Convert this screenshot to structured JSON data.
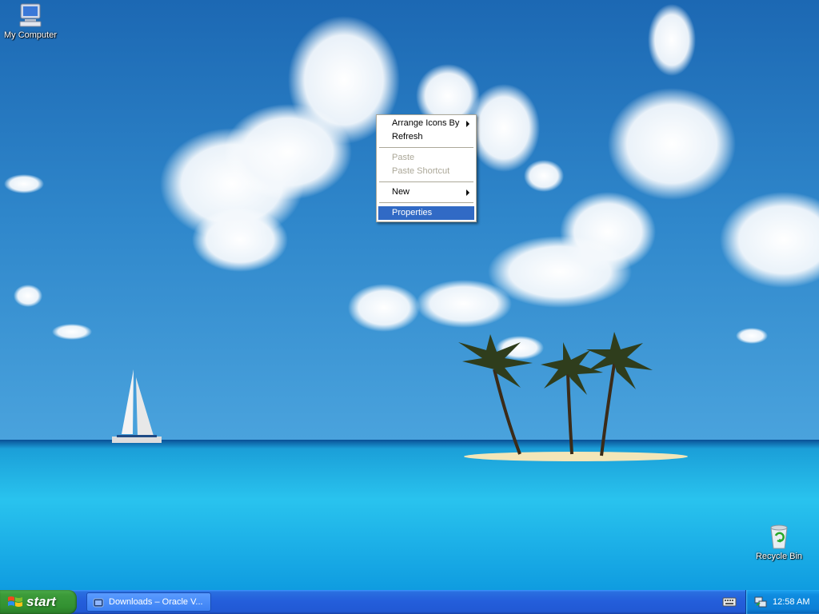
{
  "desktop": {
    "icons": [
      {
        "label": "My Computer",
        "icon": "my-computer-icon"
      },
      {
        "label": "Recycle Bin",
        "icon": "recycle-bin-icon"
      }
    ]
  },
  "context_menu": {
    "items": [
      {
        "label": "Arrange Icons By",
        "submenu": true,
        "enabled": true
      },
      {
        "label": "Refresh",
        "enabled": true
      },
      {
        "label": "Paste",
        "enabled": false
      },
      {
        "label": "Paste Shortcut",
        "enabled": false
      },
      {
        "label": "New",
        "submenu": true,
        "enabled": true
      },
      {
        "label": "Properties",
        "enabled": true,
        "highlighted": true
      }
    ]
  },
  "taskbar": {
    "start_label": "start",
    "tasks": [
      {
        "label": "Downloads – Oracle V...",
        "icon": "virtualbox-icon"
      }
    ],
    "tray": {
      "clock": "12:58 AM",
      "icons": [
        "keyboard-icon",
        "network-icon"
      ]
    }
  },
  "colors": {
    "taskbar": "#245edb",
    "start": "#329131",
    "menu_highlight": "#316ac5",
    "tray": "#0f8ce0"
  }
}
